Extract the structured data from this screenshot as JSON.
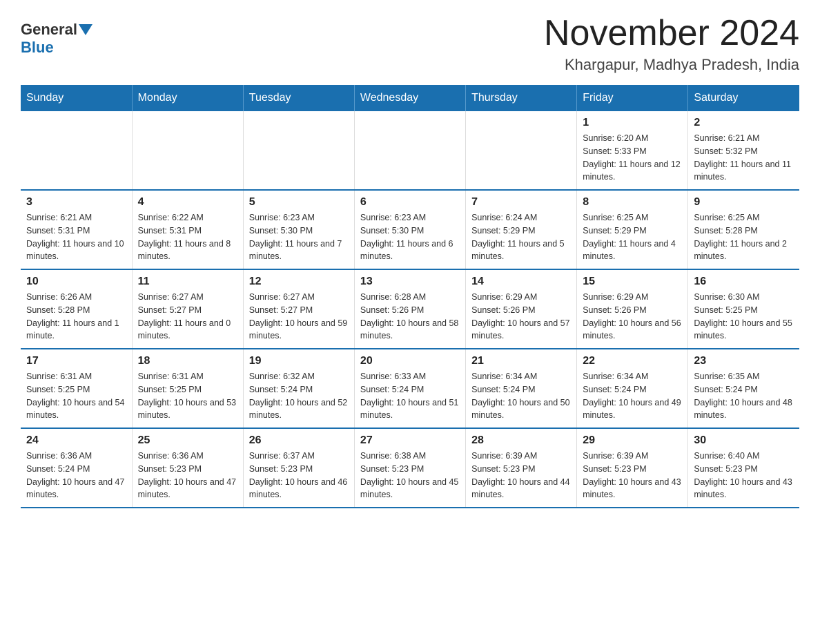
{
  "header": {
    "logo_general": "General",
    "logo_blue": "Blue",
    "title": "November 2024",
    "subtitle": "Khargapur, Madhya Pradesh, India"
  },
  "weekdays": [
    "Sunday",
    "Monday",
    "Tuesday",
    "Wednesday",
    "Thursday",
    "Friday",
    "Saturday"
  ],
  "weeks": [
    [
      {
        "day": "",
        "sunrise": "",
        "sunset": "",
        "daylight": ""
      },
      {
        "day": "",
        "sunrise": "",
        "sunset": "",
        "daylight": ""
      },
      {
        "day": "",
        "sunrise": "",
        "sunset": "",
        "daylight": ""
      },
      {
        "day": "",
        "sunrise": "",
        "sunset": "",
        "daylight": ""
      },
      {
        "day": "",
        "sunrise": "",
        "sunset": "",
        "daylight": ""
      },
      {
        "day": "1",
        "sunrise": "Sunrise: 6:20 AM",
        "sunset": "Sunset: 5:33 PM",
        "daylight": "Daylight: 11 hours and 12 minutes."
      },
      {
        "day": "2",
        "sunrise": "Sunrise: 6:21 AM",
        "sunset": "Sunset: 5:32 PM",
        "daylight": "Daylight: 11 hours and 11 minutes."
      }
    ],
    [
      {
        "day": "3",
        "sunrise": "Sunrise: 6:21 AM",
        "sunset": "Sunset: 5:31 PM",
        "daylight": "Daylight: 11 hours and 10 minutes."
      },
      {
        "day": "4",
        "sunrise": "Sunrise: 6:22 AM",
        "sunset": "Sunset: 5:31 PM",
        "daylight": "Daylight: 11 hours and 8 minutes."
      },
      {
        "day": "5",
        "sunrise": "Sunrise: 6:23 AM",
        "sunset": "Sunset: 5:30 PM",
        "daylight": "Daylight: 11 hours and 7 minutes."
      },
      {
        "day": "6",
        "sunrise": "Sunrise: 6:23 AM",
        "sunset": "Sunset: 5:30 PM",
        "daylight": "Daylight: 11 hours and 6 minutes."
      },
      {
        "day": "7",
        "sunrise": "Sunrise: 6:24 AM",
        "sunset": "Sunset: 5:29 PM",
        "daylight": "Daylight: 11 hours and 5 minutes."
      },
      {
        "day": "8",
        "sunrise": "Sunrise: 6:25 AM",
        "sunset": "Sunset: 5:29 PM",
        "daylight": "Daylight: 11 hours and 4 minutes."
      },
      {
        "day": "9",
        "sunrise": "Sunrise: 6:25 AM",
        "sunset": "Sunset: 5:28 PM",
        "daylight": "Daylight: 11 hours and 2 minutes."
      }
    ],
    [
      {
        "day": "10",
        "sunrise": "Sunrise: 6:26 AM",
        "sunset": "Sunset: 5:28 PM",
        "daylight": "Daylight: 11 hours and 1 minute."
      },
      {
        "day": "11",
        "sunrise": "Sunrise: 6:27 AM",
        "sunset": "Sunset: 5:27 PM",
        "daylight": "Daylight: 11 hours and 0 minutes."
      },
      {
        "day": "12",
        "sunrise": "Sunrise: 6:27 AM",
        "sunset": "Sunset: 5:27 PM",
        "daylight": "Daylight: 10 hours and 59 minutes."
      },
      {
        "day": "13",
        "sunrise": "Sunrise: 6:28 AM",
        "sunset": "Sunset: 5:26 PM",
        "daylight": "Daylight: 10 hours and 58 minutes."
      },
      {
        "day": "14",
        "sunrise": "Sunrise: 6:29 AM",
        "sunset": "Sunset: 5:26 PM",
        "daylight": "Daylight: 10 hours and 57 minutes."
      },
      {
        "day": "15",
        "sunrise": "Sunrise: 6:29 AM",
        "sunset": "Sunset: 5:26 PM",
        "daylight": "Daylight: 10 hours and 56 minutes."
      },
      {
        "day": "16",
        "sunrise": "Sunrise: 6:30 AM",
        "sunset": "Sunset: 5:25 PM",
        "daylight": "Daylight: 10 hours and 55 minutes."
      }
    ],
    [
      {
        "day": "17",
        "sunrise": "Sunrise: 6:31 AM",
        "sunset": "Sunset: 5:25 PM",
        "daylight": "Daylight: 10 hours and 54 minutes."
      },
      {
        "day": "18",
        "sunrise": "Sunrise: 6:31 AM",
        "sunset": "Sunset: 5:25 PM",
        "daylight": "Daylight: 10 hours and 53 minutes."
      },
      {
        "day": "19",
        "sunrise": "Sunrise: 6:32 AM",
        "sunset": "Sunset: 5:24 PM",
        "daylight": "Daylight: 10 hours and 52 minutes."
      },
      {
        "day": "20",
        "sunrise": "Sunrise: 6:33 AM",
        "sunset": "Sunset: 5:24 PM",
        "daylight": "Daylight: 10 hours and 51 minutes."
      },
      {
        "day": "21",
        "sunrise": "Sunrise: 6:34 AM",
        "sunset": "Sunset: 5:24 PM",
        "daylight": "Daylight: 10 hours and 50 minutes."
      },
      {
        "day": "22",
        "sunrise": "Sunrise: 6:34 AM",
        "sunset": "Sunset: 5:24 PM",
        "daylight": "Daylight: 10 hours and 49 minutes."
      },
      {
        "day": "23",
        "sunrise": "Sunrise: 6:35 AM",
        "sunset": "Sunset: 5:24 PM",
        "daylight": "Daylight: 10 hours and 48 minutes."
      }
    ],
    [
      {
        "day": "24",
        "sunrise": "Sunrise: 6:36 AM",
        "sunset": "Sunset: 5:24 PM",
        "daylight": "Daylight: 10 hours and 47 minutes."
      },
      {
        "day": "25",
        "sunrise": "Sunrise: 6:36 AM",
        "sunset": "Sunset: 5:23 PM",
        "daylight": "Daylight: 10 hours and 47 minutes."
      },
      {
        "day": "26",
        "sunrise": "Sunrise: 6:37 AM",
        "sunset": "Sunset: 5:23 PM",
        "daylight": "Daylight: 10 hours and 46 minutes."
      },
      {
        "day": "27",
        "sunrise": "Sunrise: 6:38 AM",
        "sunset": "Sunset: 5:23 PM",
        "daylight": "Daylight: 10 hours and 45 minutes."
      },
      {
        "day": "28",
        "sunrise": "Sunrise: 6:39 AM",
        "sunset": "Sunset: 5:23 PM",
        "daylight": "Daylight: 10 hours and 44 minutes."
      },
      {
        "day": "29",
        "sunrise": "Sunrise: 6:39 AM",
        "sunset": "Sunset: 5:23 PM",
        "daylight": "Daylight: 10 hours and 43 minutes."
      },
      {
        "day": "30",
        "sunrise": "Sunrise: 6:40 AM",
        "sunset": "Sunset: 5:23 PM",
        "daylight": "Daylight: 10 hours and 43 minutes."
      }
    ]
  ]
}
